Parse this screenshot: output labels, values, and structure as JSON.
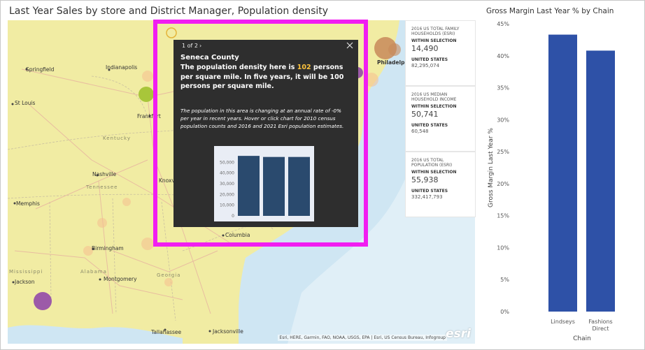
{
  "map": {
    "title": "Last Year Sales by store and District Manager, Population density",
    "attribution": "Esri, HERE, Garmin, FAO, NOAA, USGS, EPA | Esri, US Census Bureau, Infogroup",
    "esri_logo": "esri",
    "cities": [
      "Springfield",
      "Indianapolis",
      "St Louis",
      "Frankfort",
      "Kentucky",
      "Nashville",
      "Tennessee",
      "Knoxville",
      "Memphis",
      "Birmingham",
      "Alabama",
      "Mississippi",
      "Jackson",
      "Montgomery",
      "Georgia",
      "Columbia",
      "Tallahassee",
      "Jacksonville",
      "Philadelphia"
    ],
    "marker_colors": {
      "olive": "#a8c63a",
      "purple": "#9c5aa8",
      "brown": "#c8895a",
      "gold": "#e4b43a"
    }
  },
  "cards": [
    {
      "title": "2016 US TOTAL FAMILY HOUSEHOLDS (ESRI)",
      "within_label": "WITHIN SELECTION",
      "within_value": "14,490",
      "us_label": "UNITED STATES",
      "us_value": "82,295,074"
    },
    {
      "title": "2016 US MEDIAN HOUSEHOLD INCOME",
      "within_label": "WITHIN SELECTION",
      "within_value": "50,741",
      "us_label": "UNITED STATES",
      "us_value": "60,548"
    },
    {
      "title": "2016 US TOTAL POPULATION (ESRI)",
      "within_label": "WITHIN SELECTION",
      "within_value": "55,938",
      "us_label": "UNITED STATES",
      "us_value": "332,417,793"
    }
  ],
  "popup": {
    "pager": "1 of 2",
    "title": "Seneca County",
    "text_before": "The population density here is ",
    "highlight": "102",
    "text_after": " persons per square mile. In five years, it will be 100 persons per square mile.",
    "note": "The population in this area is changing at an annual rate of -0% per year in recent years. Hover or click chart for 2010 census population counts and 2016 and 2021 Esri population estimates.",
    "chart": {
      "values": [
        56000,
        55000,
        55000
      ],
      "ticks": [
        "50,000",
        "40,000",
        "30,000",
        "20,000",
        "10,000",
        "0"
      ],
      "max": 60000,
      "bar_color": "#2a4a6e"
    }
  },
  "chart_data": {
    "type": "bar",
    "title": "Gross Margin Last Year % by Chain",
    "xlabel": "Chain",
    "ylabel": "Gross Margin Last Year %",
    "categories": [
      "Lindseys",
      "Fashions Direct"
    ],
    "values": [
      43.3,
      40.8
    ],
    "ylim": [
      0,
      45
    ],
    "yticks": [
      "45%",
      "40%",
      "35%",
      "30%",
      "25%",
      "20%",
      "15%",
      "10%",
      "5%",
      "0%"
    ],
    "bar_color": "#2e51a7",
    "grid": false
  }
}
